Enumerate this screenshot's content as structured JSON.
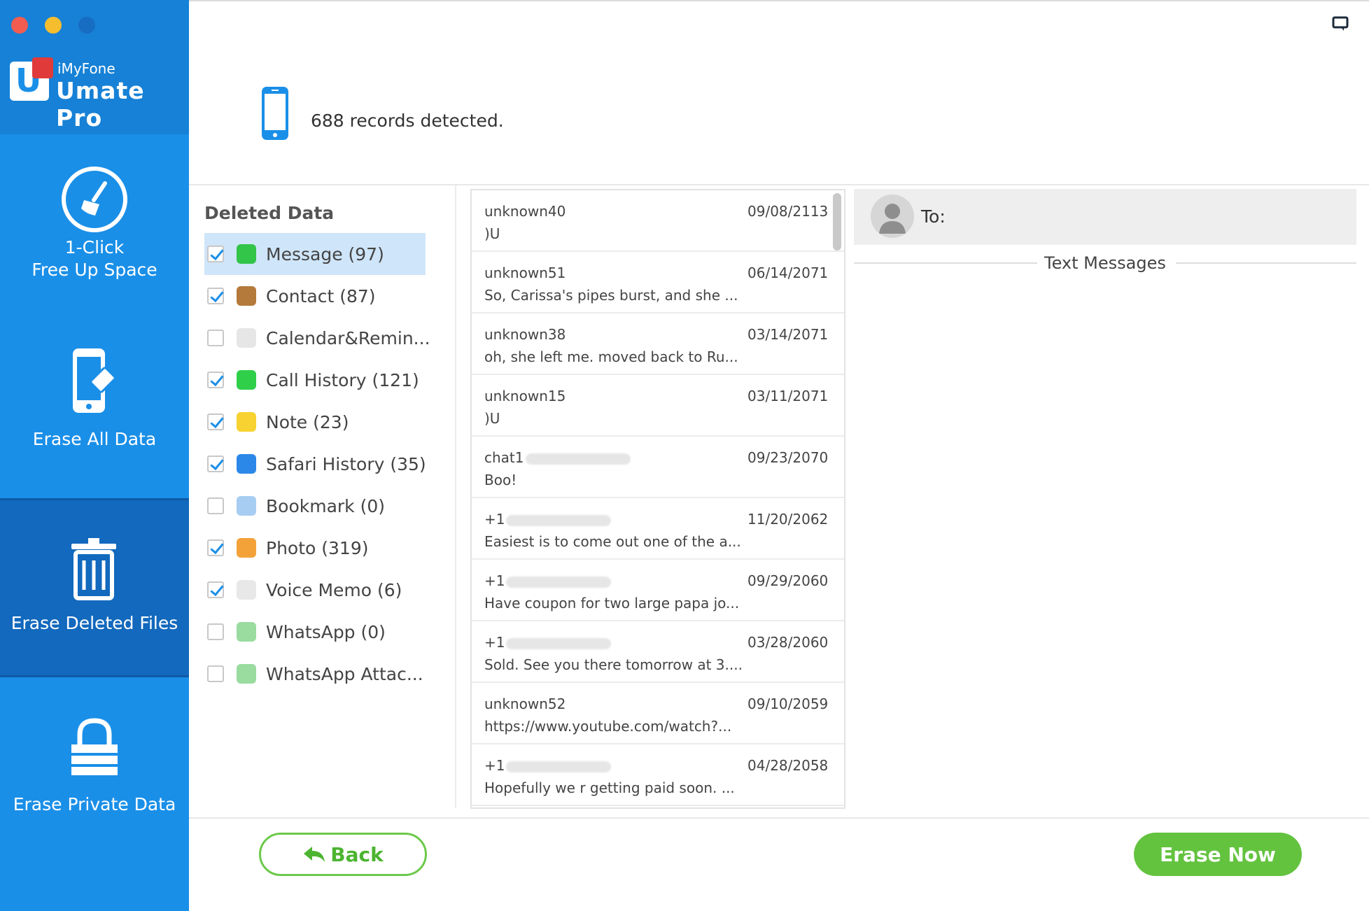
{
  "app": {
    "brand_small": "iMyFone",
    "brand_big": "Umate Pro",
    "window_controls": [
      "close",
      "minimize",
      "zoom"
    ]
  },
  "sidebar": {
    "items": [
      {
        "label_line1": "1-Click",
        "label_line2": "Free Up Space",
        "icon": "broom-icon",
        "active": false
      },
      {
        "label": "Erase All Data",
        "icon": "phone-eraser-icon",
        "active": false
      },
      {
        "label": "Erase Deleted Files",
        "icon": "trash-icon",
        "active": true
      },
      {
        "label": "Erase Private Data",
        "icon": "lock-icon",
        "active": false
      }
    ]
  },
  "header": {
    "records_text": "688 records detected.",
    "icon": "phone-icon",
    "feedback_icon": "feedback-icon"
  },
  "categories": {
    "title": "Deleted Data",
    "items": [
      {
        "label": "Message (97)",
        "checked": true,
        "selected": true,
        "icon": "message-icon",
        "color": "#33c44a"
      },
      {
        "label": "Contact (87)",
        "checked": true,
        "selected": false,
        "icon": "contact-icon",
        "color": "#b47a3c"
      },
      {
        "label": "Calendar&Remin...",
        "checked": false,
        "selected": false,
        "icon": "calendar-icon",
        "color": "#e6e6e6"
      },
      {
        "label": "Call History (121)",
        "checked": true,
        "selected": false,
        "icon": "phone-call-icon",
        "color": "#2fcf4a"
      },
      {
        "label": "Note (23)",
        "checked": true,
        "selected": false,
        "icon": "note-icon",
        "color": "#f7d230"
      },
      {
        "label": "Safari History (35)",
        "checked": true,
        "selected": false,
        "icon": "safari-icon",
        "color": "#2c88e8"
      },
      {
        "label": "Bookmark (0)",
        "checked": false,
        "selected": false,
        "icon": "bookmark-icon",
        "color": "#a7cdf2"
      },
      {
        "label": "Photo (319)",
        "checked": true,
        "selected": false,
        "icon": "photo-icon",
        "color": "#f3a23a"
      },
      {
        "label": "Voice Memo (6)",
        "checked": true,
        "selected": false,
        "icon": "voice-memo-icon",
        "color": "#e8e8e8"
      },
      {
        "label": "WhatsApp (0)",
        "checked": false,
        "selected": false,
        "icon": "whatsapp-icon",
        "color": "#9adba0"
      },
      {
        "label": "WhatsApp Attac...",
        "checked": false,
        "selected": false,
        "icon": "whatsapp-attachment-icon",
        "color": "#9adba0"
      }
    ]
  },
  "messages": {
    "rows": [
      {
        "sender": "unknown40",
        "blurred": false,
        "date": "09/08/2113",
        "preview": ")U"
      },
      {
        "sender": "unknown51",
        "blurred": false,
        "date": "06/14/2071",
        "preview": "So, Carissa's pipes burst, and she ..."
      },
      {
        "sender": "unknown38",
        "blurred": false,
        "date": "03/14/2071",
        "preview": "oh, she left me. moved back to Ru..."
      },
      {
        "sender": "unknown15",
        "blurred": false,
        "date": "03/11/2071",
        "preview": ")U"
      },
      {
        "sender": "chat1",
        "blurred": true,
        "date": "09/23/2070",
        "preview": "Boo!"
      },
      {
        "sender": "+1",
        "blurred": true,
        "date": "11/20/2062",
        "preview": "Easiest is to come out one of the a..."
      },
      {
        "sender": "+1",
        "blurred": true,
        "date": "09/29/2060",
        "preview": "Have coupon for two large papa jo..."
      },
      {
        "sender": "+1",
        "blurred": true,
        "date": "03/28/2060",
        "preview": "Sold. See you there tomorrow at 3...."
      },
      {
        "sender": "unknown52",
        "blurred": false,
        "date": "09/10/2059",
        "preview": "https://www.youtube.com/watch?..."
      },
      {
        "sender": "+1",
        "blurred": true,
        "date": "04/28/2058",
        "preview": "Hopefully we r getting paid soon. ..."
      }
    ]
  },
  "detail": {
    "to_label": "To:",
    "section_label": "Text Messages"
  },
  "footer": {
    "back_label": "Back",
    "erase_label": "Erase Now"
  },
  "colors": {
    "sidebar": "#1a8fe8",
    "sidebar_active": "#1269bd",
    "accent_green": "#63c33f",
    "selected_row": "#cfe5f9"
  }
}
